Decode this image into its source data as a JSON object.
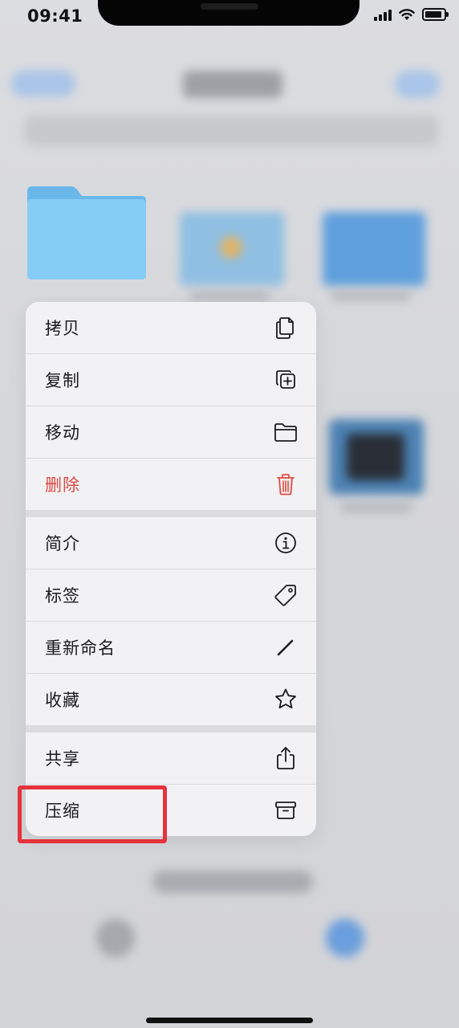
{
  "status_bar": {
    "time": "09:41",
    "icons": [
      "signal-icon",
      "wifi-icon",
      "battery-icon"
    ]
  },
  "selected_item": {
    "icon": "folder-icon",
    "color": "#7cc6f2"
  },
  "context_menu": {
    "groups": [
      [
        {
          "label": "拷贝",
          "icon": "copy-docs-icon"
        },
        {
          "label": "复制",
          "icon": "duplicate-icon"
        },
        {
          "label": "移动",
          "icon": "folder-outline-icon"
        },
        {
          "label": "删除",
          "icon": "trash-icon",
          "destructive": true
        }
      ],
      [
        {
          "label": "简介",
          "icon": "info-icon"
        },
        {
          "label": "标签",
          "icon": "tag-icon"
        },
        {
          "label": "重新命名",
          "icon": "pencil-icon"
        },
        {
          "label": "收藏",
          "icon": "star-icon"
        }
      ],
      [
        {
          "label": "共享",
          "icon": "share-icon"
        },
        {
          "label": "压缩",
          "icon": "archive-box-icon"
        }
      ]
    ]
  },
  "colors": {
    "destructive": "#e0483f",
    "highlight": "#e6323c",
    "menu_bg": "#f2f2f4"
  }
}
